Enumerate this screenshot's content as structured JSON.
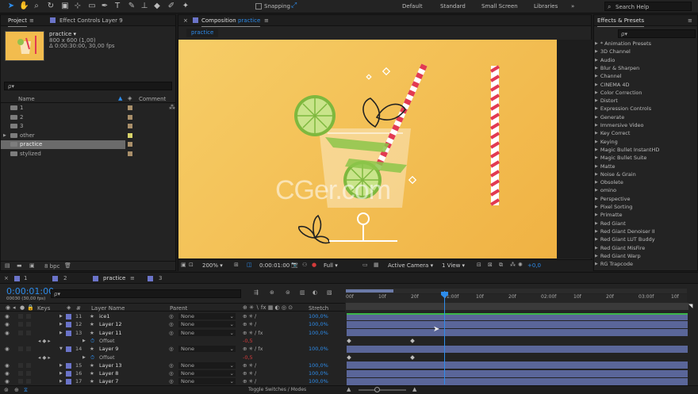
{
  "toolbar": {
    "snapping_label": "Snapping",
    "workspaces": [
      "Default",
      "Standard",
      "Small Screen",
      "Libraries"
    ],
    "search_help": "Search Help"
  },
  "project": {
    "tab_project": "Project",
    "tab_effect_controls": "Effect Controls Layer 9",
    "comp_name": "practice ▾",
    "comp_size": "800 x 600 (1,00)",
    "comp_duration": "Δ 0:00:30:00, 30,00 fps",
    "search_placeholder": "ρ▾",
    "col_name": "Name",
    "col_comment": "Comment",
    "items": [
      {
        "name": "1",
        "selected": false
      },
      {
        "name": "2",
        "selected": false
      },
      {
        "name": "3",
        "selected": false
      },
      {
        "name": "other",
        "selected": false
      },
      {
        "name": "practice",
        "selected": true
      },
      {
        "name": "stylized",
        "selected": false
      }
    ],
    "bpc": "8 bpc"
  },
  "composition": {
    "tab_label": "Composition",
    "tab_name": "practice",
    "subtab": "practice",
    "zoom": "200%",
    "timecode": "0:00:01:00",
    "resolution": "Full",
    "camera": "Active Camera",
    "view": "1 View",
    "exposure": "+0,0",
    "watermark": "CGer.com"
  },
  "effects": {
    "title": "Effects & Presets",
    "search_placeholder": "ρ▾",
    "items": [
      "* Animation Presets",
      "3D Channel",
      "Audio",
      "Blur & Sharpen",
      "Channel",
      "CINEMA 4D",
      "Color Correction",
      "Distort",
      "Expression Controls",
      "Generate",
      "Immersive Video",
      "Key Correct",
      "Keying",
      "Magic Bullet InstantHD",
      "Magic Bullet Suite",
      "Matte",
      "Noise & Grain",
      "Obsolete",
      "omino",
      "Perspective",
      "Pixel Sorting",
      "Primatte",
      "Red Giant",
      "Red Giant Denoiser II",
      "Red Giant LUT Buddy",
      "Red Giant MisFire",
      "Red Giant Warp",
      "RG Trapcode"
    ]
  },
  "timeline": {
    "tabs": [
      "1",
      "2",
      "practice",
      "3"
    ],
    "timecode": "0:00:01:00",
    "frame_info": "00030 (30,00 fps)",
    "search_placeholder": "ρ▾",
    "col_keys": "Keys",
    "col_num": "#",
    "col_layer": "Layer Name",
    "col_parent": "Parent",
    "col_stretch": "Stretch",
    "ruler": [
      "00f",
      "10f",
      "20f",
      "01:00f",
      "10f",
      "20f",
      "02:00f",
      "10f",
      "20f",
      "03:00f",
      "10f"
    ],
    "layers": [
      {
        "num": "11",
        "name": "ice1",
        "parent": "None",
        "stretch": "100,0%",
        "sub": false
      },
      {
        "num": "12",
        "name": "Layer 12",
        "parent": "None",
        "stretch": "100,0%",
        "sub": false
      },
      {
        "num": "13",
        "name": "Layer 11",
        "parent": "None",
        "stretch": "100,0%",
        "sub": false
      },
      {
        "num": "",
        "name": "Offset",
        "parent": "",
        "stretch": "",
        "value": "-0,5",
        "sub": true
      },
      {
        "num": "14",
        "name": "Layer 9",
        "parent": "None",
        "stretch": "100,0%",
        "sub": false
      },
      {
        "num": "",
        "name": "Offset",
        "parent": "",
        "stretch": "",
        "value": "-0,5",
        "sub": true
      },
      {
        "num": "15",
        "name": "Layer 13",
        "parent": "None",
        "stretch": "100,0%",
        "sub": false
      },
      {
        "num": "16",
        "name": "Layer 8",
        "parent": "None",
        "stretch": "100,0%",
        "sub": false
      },
      {
        "num": "17",
        "name": "Layer 7",
        "parent": "None",
        "stretch": "100,0%",
        "sub": false
      }
    ],
    "toggle_label": "Toggle Switches / Modes"
  },
  "colors": {
    "accent": "#2d8ceb",
    "label": "#6b74c9",
    "comp_bg": "#f2bc4e",
    "straw": "#e23a52"
  }
}
